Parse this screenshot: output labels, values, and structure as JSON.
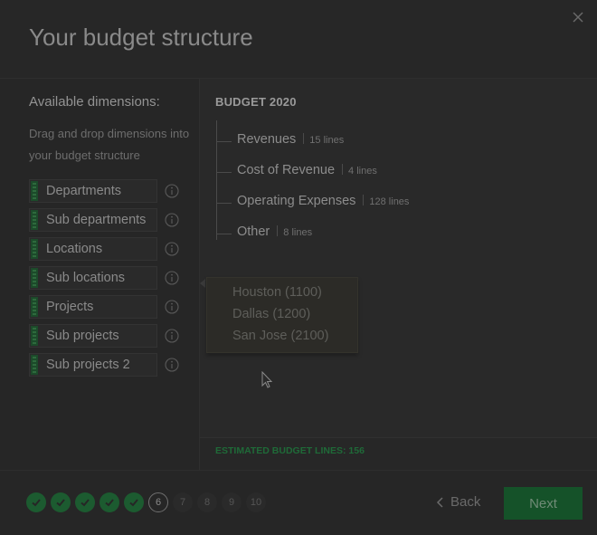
{
  "dialog": {
    "title": "Your budget structure",
    "close_icon": "close-icon"
  },
  "left": {
    "title": "Available dimensions:",
    "description": "Drag and drop dimensions into your budget structure",
    "dimensions": [
      {
        "label": "Departments"
      },
      {
        "label": "Sub departments"
      },
      {
        "label": "Locations"
      },
      {
        "label": "Sub locations"
      },
      {
        "label": "Projects"
      },
      {
        "label": "Sub projects"
      },
      {
        "label": "Sub projects 2"
      }
    ]
  },
  "budget": {
    "title": "BUDGET 2020",
    "rows": [
      {
        "name": "Revenues",
        "count": "15 lines"
      },
      {
        "name": "Cost of Revenue",
        "count": "4 lines"
      },
      {
        "name": "Operating Expenses",
        "count": "128 lines"
      },
      {
        "name": "Other",
        "count": "8 lines"
      }
    ],
    "popover_items": [
      "Houston (1100)",
      "Dallas (1200)",
      "San Jose (2100)"
    ],
    "estimated": "ESTIMATED BUDGET LINES: 156"
  },
  "footer": {
    "steps": [
      {
        "state": "done",
        "label": ""
      },
      {
        "state": "done",
        "label": ""
      },
      {
        "state": "done",
        "label": ""
      },
      {
        "state": "done",
        "label": ""
      },
      {
        "state": "done",
        "label": ""
      },
      {
        "state": "current",
        "label": "6"
      },
      {
        "state": "todo",
        "label": "7"
      },
      {
        "state": "todo",
        "label": "8"
      },
      {
        "state": "todo",
        "label": "9"
      },
      {
        "state": "todo",
        "label": "10"
      }
    ],
    "back_label": "Back",
    "next_label": "Next"
  },
  "colors": {
    "accent": "#1c5b30",
    "estimated_text": "#1f6a38"
  }
}
